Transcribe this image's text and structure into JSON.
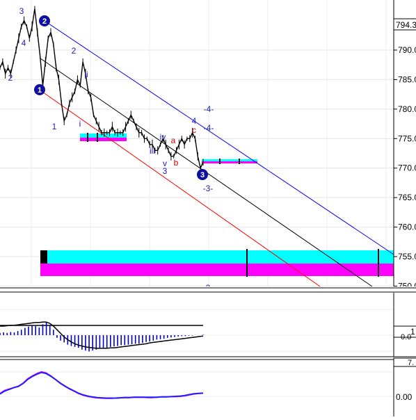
{
  "chart_data": [
    {
      "type": "line",
      "panel": "price",
      "title": "",
      "xlabel": "",
      "ylabel": "",
      "ylim": [
        750,
        797
      ],
      "y_ticks": [
        "790.0",
        "785.0",
        "780.0",
        "775.0",
        "770.0",
        "765.0",
        "760.0",
        "755.0",
        "750.0"
      ],
      "last_price_label": "794.3",
      "grid": true,
      "series": [
        {
          "values": [
            787,
            788,
            786,
            787,
            786,
            788,
            790,
            792,
            794,
            795,
            794,
            792,
            794,
            797,
            793,
            789,
            784,
            788,
            792,
            793,
            791,
            787,
            785,
            781,
            778,
            779,
            781,
            782,
            783,
            785,
            784,
            788,
            786,
            783,
            782,
            779,
            778,
            777,
            776,
            776,
            776,
            776,
            777,
            776,
            776,
            776,
            776,
            777,
            778,
            779,
            778,
            777,
            776,
            776,
            775,
            775,
            774,
            774,
            773,
            773,
            774,
            775,
            774,
            773,
            772,
            772,
            773,
            774,
            775,
            774,
            775,
            775,
            776,
            775,
            772,
            770,
            771
          ]
        }
      ],
      "wave_labels_blue": [
        "3",
        "4",
        "2",
        "1",
        "2",
        "ii",
        "i",
        "iv",
        "iii",
        "v",
        "3",
        "4",
        "-4-",
        "-4-",
        "-3-",
        "-3"
      ],
      "wave_labels_red": [
        "a",
        "b",
        "c"
      ],
      "circled_labels": [
        "1",
        "2",
        "3"
      ],
      "zone_labels": [],
      "colors": {
        "blue_line": "#0000ff",
        "red_line": "#ff0000",
        "cyan_zone": "#00ffff",
        "magenta_zone": "#ff00ff",
        "price_line": "#000000",
        "wave_blue": "#2020c0",
        "wave_red": "#d00000"
      }
    },
    {
      "type": "bar",
      "panel": "oscillator",
      "title": "",
      "y_ticks": [
        "1",
        "0.0"
      ],
      "description": "blue histogram with black signal line",
      "histogram": [
        0.5,
        0.6,
        0.5,
        0.7,
        0.6,
        0.9,
        1.2,
        1.6,
        1.9,
        2.2,
        2.0,
        1.7,
        2.4,
        3.0,
        2.2,
        1.2,
        -0.6,
        -1.2,
        -1.6,
        -2.1,
        -2.4,
        -2.6,
        -2.8,
        -3.2,
        -3.4,
        -3.6,
        -3.4,
        -3.2,
        -3.0,
        -2.9,
        -2.8,
        -2.6,
        -2.5,
        -2.4,
        -2.2,
        -2.2,
        -2.1,
        -2.0,
        -1.9,
        -1.9,
        -1.7,
        -1.5,
        -1.4,
        -1.2,
        -1.0,
        -0.9,
        -0.8,
        -0.6,
        -0.5,
        -0.4,
        -0.3,
        -0.2,
        -0.2,
        -0.1,
        -0.1,
        0.0,
        0.0,
        0.1
      ],
      "signal": [
        2.0,
        2.0,
        2.1,
        2.2,
        2.2,
        2.3,
        2.4,
        2.5,
        2.6,
        2.7,
        2.8,
        2.8,
        2.9,
        2.9,
        2.6,
        2.0,
        1.2,
        0.4,
        -0.4,
        -1.0,
        -1.5,
        -1.9,
        -2.2,
        -2.4,
        -2.6,
        -2.7,
        -2.8,
        -2.9,
        -2.9,
        -2.9,
        -2.9,
        -2.8,
        -2.8,
        -2.7,
        -2.6,
        -2.5,
        -2.4,
        -2.3,
        -2.2,
        -2.1,
        -2.0,
        -1.9,
        -1.7,
        -1.6,
        -1.5,
        -1.4,
        -1.3,
        -1.2,
        -1.1,
        -1.0,
        -0.9,
        -0.8,
        -0.7,
        -0.6,
        -0.5,
        -0.4,
        -0.3,
        -0.2
      ],
      "zero_line": [
        1.3,
        1.3
      ],
      "colors": {
        "histogram": "#0000cc",
        "signal": "#000000"
      }
    },
    {
      "type": "line",
      "panel": "momentum",
      "title": "",
      "y_ticks": [
        "7.",
        "0.00"
      ],
      "series": [
        {
          "color": "#ff00ff",
          "values": [
            1,
            2,
            2.5,
            3,
            3.5,
            4.5,
            6,
            7,
            7.8,
            8.4,
            8.0,
            7.0,
            5.8,
            4.5,
            3.5,
            2.6,
            1.8,
            1.0,
            0.4,
            0.0,
            -0.3,
            -0.5,
            -0.6,
            -0.7,
            -0.7,
            -0.6,
            -0.5,
            -0.4,
            -0.4,
            -0.3,
            -0.3,
            -0.3,
            -0.4,
            -0.4,
            -0.3,
            -0.2,
            -0.2,
            -0.1,
            -0.1,
            0.0,
            0.2,
            0.5,
            0.8,
            1.0,
            1.1
          ]
        },
        {
          "color": "#2020ff",
          "values": [
            0.8,
            1.8,
            2.4,
            3,
            3.4,
            4.4,
            5.8,
            6.8,
            7.6,
            8.2,
            7.8,
            6.9,
            5.8,
            4.6,
            3.6,
            2.7,
            1.9,
            1.1,
            0.5,
            0.1,
            -0.2,
            -0.4,
            -0.5,
            -0.6,
            -0.6,
            -0.6,
            -0.5,
            -0.4,
            -0.4,
            -0.3,
            -0.3,
            -0.3,
            -0.3,
            -0.3,
            -0.3,
            -0.2,
            -0.2,
            -0.1,
            0.0,
            0.1,
            0.3,
            0.6,
            0.9,
            1.0,
            1.1
          ]
        }
      ],
      "colors": {
        "a": "#ff00ff",
        "b": "#2020ff"
      }
    }
  ]
}
